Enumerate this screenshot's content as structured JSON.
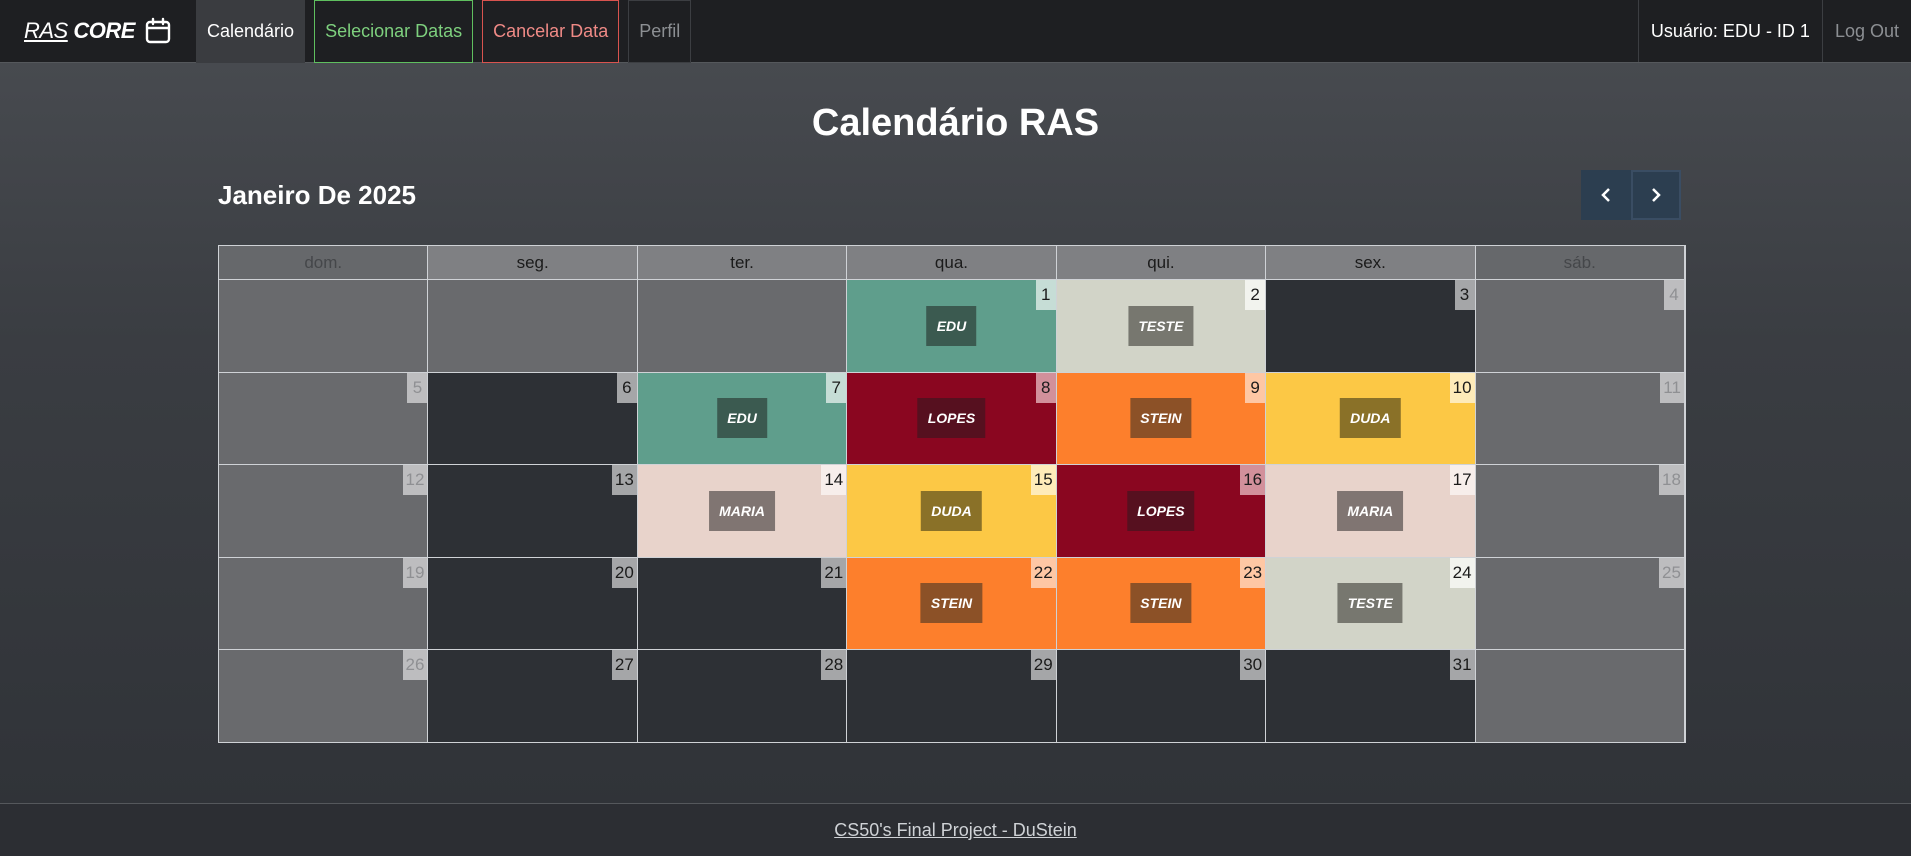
{
  "navbar": {
    "brand_part1": "RAS",
    "brand_part2": "CORE",
    "brand_icon": "calendar-icon",
    "links": {
      "calendar": "Calendário",
      "select_dates": "Selecionar Datas",
      "cancel_date": "Cancelar Data",
      "profile": "Perfil"
    },
    "user": "Usuário: EDU - ID 1",
    "logout": "Log Out"
  },
  "page": {
    "title": "Calendário RAS",
    "month": "Janeiro De 2025",
    "prev_icon": "chevron-left-icon",
    "next_icon": "chevron-right-icon"
  },
  "calendar": {
    "weekdays": [
      "dom.",
      "seg.",
      "ter.",
      "qua.",
      "qui.",
      "sex.",
      "sáb."
    ],
    "weeks": [
      [
        null,
        null,
        null,
        {
          "day": "1",
          "tag": "EDU"
        },
        {
          "day": "2",
          "tag": "TESTE"
        },
        {
          "day": "3"
        },
        {
          "day": "4"
        }
      ],
      [
        {
          "day": "5"
        },
        {
          "day": "6"
        },
        {
          "day": "7",
          "tag": "EDU"
        },
        {
          "day": "8",
          "tag": "LOPES"
        },
        {
          "day": "9",
          "tag": "STEIN"
        },
        {
          "day": "10",
          "tag": "DUDA"
        },
        {
          "day": "11"
        }
      ],
      [
        {
          "day": "12"
        },
        {
          "day": "13"
        },
        {
          "day": "14",
          "tag": "MARIA"
        },
        {
          "day": "15",
          "tag": "DUDA"
        },
        {
          "day": "16",
          "tag": "LOPES"
        },
        {
          "day": "17",
          "tag": "MARIA"
        },
        {
          "day": "18"
        }
      ],
      [
        {
          "day": "19"
        },
        {
          "day": "20"
        },
        {
          "day": "21"
        },
        {
          "day": "22",
          "tag": "STEIN"
        },
        {
          "day": "23",
          "tag": "STEIN"
        },
        {
          "day": "24",
          "tag": "TESTE"
        },
        {
          "day": "25"
        }
      ],
      [
        {
          "day": "26"
        },
        {
          "day": "27"
        },
        {
          "day": "28"
        },
        {
          "day": "29"
        },
        {
          "day": "30"
        },
        {
          "day": "31"
        },
        null
      ]
    ],
    "tag_colors": {
      "EDU": "#5f9e8c",
      "TESTE": "#d2d4c8",
      "LOPES": "#8a0620",
      "STEIN": "#fd7f2c",
      "DUDA": "#fcc845",
      "MARIA": "#e8d3cb"
    }
  },
  "footer": {
    "link": "CS50's Final Project - DuStein"
  }
}
